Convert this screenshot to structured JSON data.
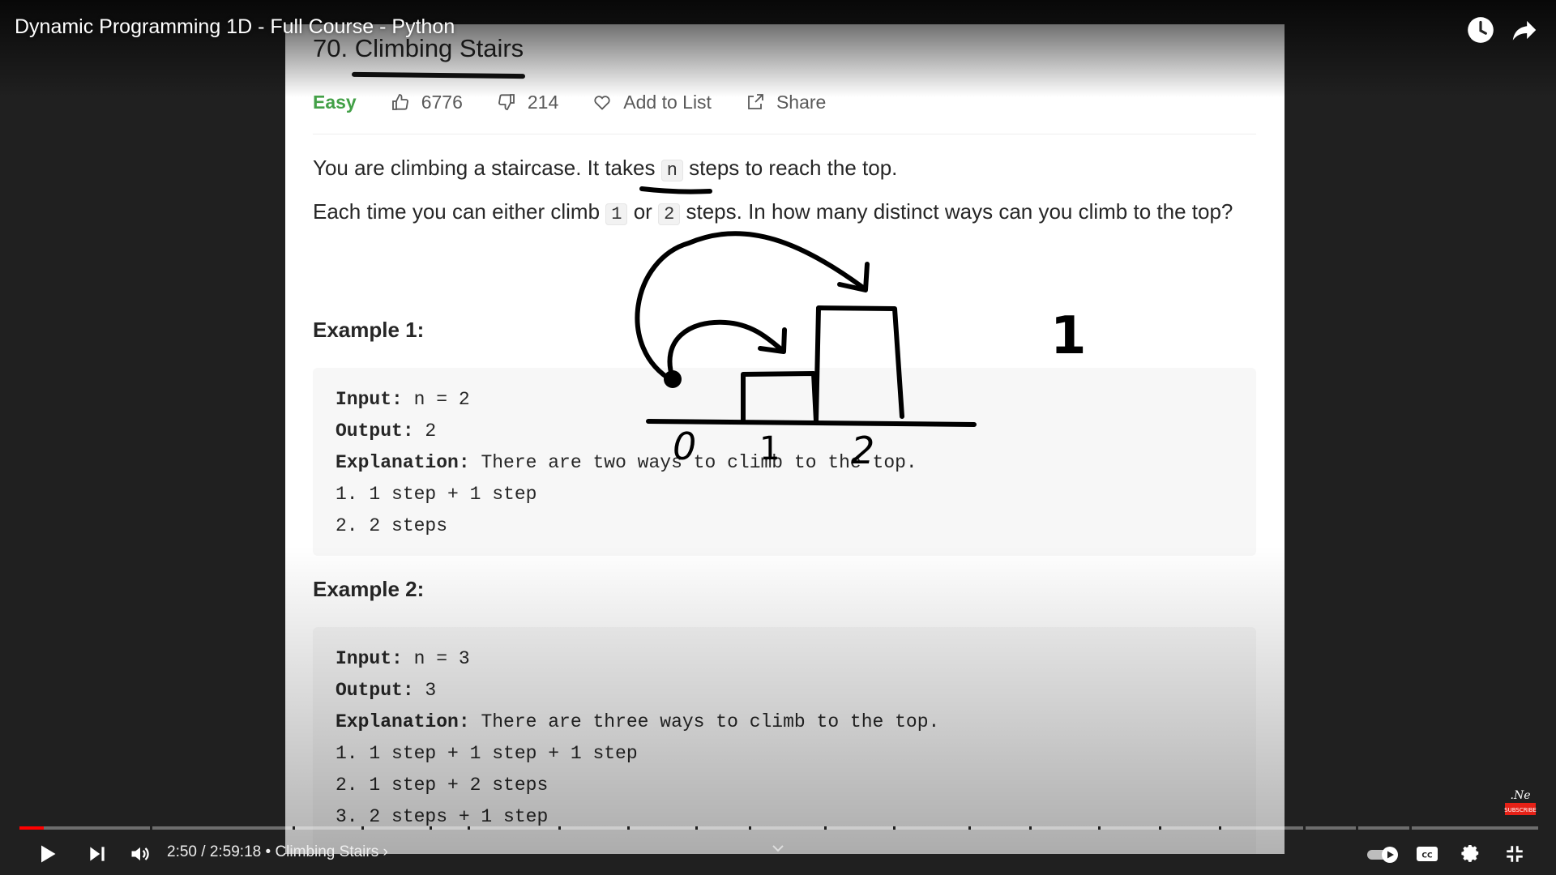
{
  "video": {
    "title": "Dynamic Programming 1D - Full Course - Python",
    "time_current": "2:50",
    "time_separator": " / ",
    "time_total": "2:59:18",
    "chapter_separator": " • ",
    "chapter": "Climbing Stairs",
    "chapter_chevron": "›",
    "progress_fraction": 0.0158,
    "chapter_marks_fraction": [
      0.086,
      0.18,
      0.225,
      0.27,
      0.295,
      0.355,
      0.4,
      0.445,
      0.48,
      0.53,
      0.575,
      0.625,
      0.665,
      0.71,
      0.75,
      0.79,
      0.845,
      0.88,
      0.915
    ],
    "subscribe_watermark": "SUBSCRIBE"
  },
  "problem": {
    "title": "70. Climbing Stairs",
    "difficulty": "Easy",
    "likes": "6776",
    "dislikes": "214",
    "add_to_list": "Add to List",
    "share": "Share",
    "desc1_pre": "You are climbing a staircase. It takes ",
    "desc1_code": "n",
    "desc1_post": " steps to reach the top.",
    "desc2_pre": "Each time you can either climb ",
    "desc2_code1": "1",
    "desc2_mid": " or ",
    "desc2_code2": "2",
    "desc2_post": " steps. In how many distinct ways can you climb to the top?",
    "example1": {
      "title": "Example 1:",
      "input_label": "Input:",
      "input_value": " n = 2",
      "output_label": "Output:",
      "output_value": " 2",
      "explanation_label": "Explanation:",
      "explanation_value": " There are two ways to climb to the top.",
      "lines": [
        "1. 1 step + 1 step",
        "2. 2 steps"
      ]
    },
    "example2": {
      "title": "Example 2:",
      "input_label": "Input:",
      "input_value": " n = 3",
      "output_label": "Output:",
      "output_value": " 3",
      "explanation_label": "Explanation:",
      "explanation_value": " There are three ways to climb to the top.",
      "lines": [
        "1. 1 step + 1 step + 1 step",
        "2. 1 step + 2 steps",
        "3. 2 steps + 1 step"
      ]
    }
  },
  "drawing": {
    "labels": [
      "0",
      "1",
      "2",
      "1"
    ]
  },
  "colors": {
    "progress_played": "#ff0000",
    "easy": "#43a047"
  }
}
